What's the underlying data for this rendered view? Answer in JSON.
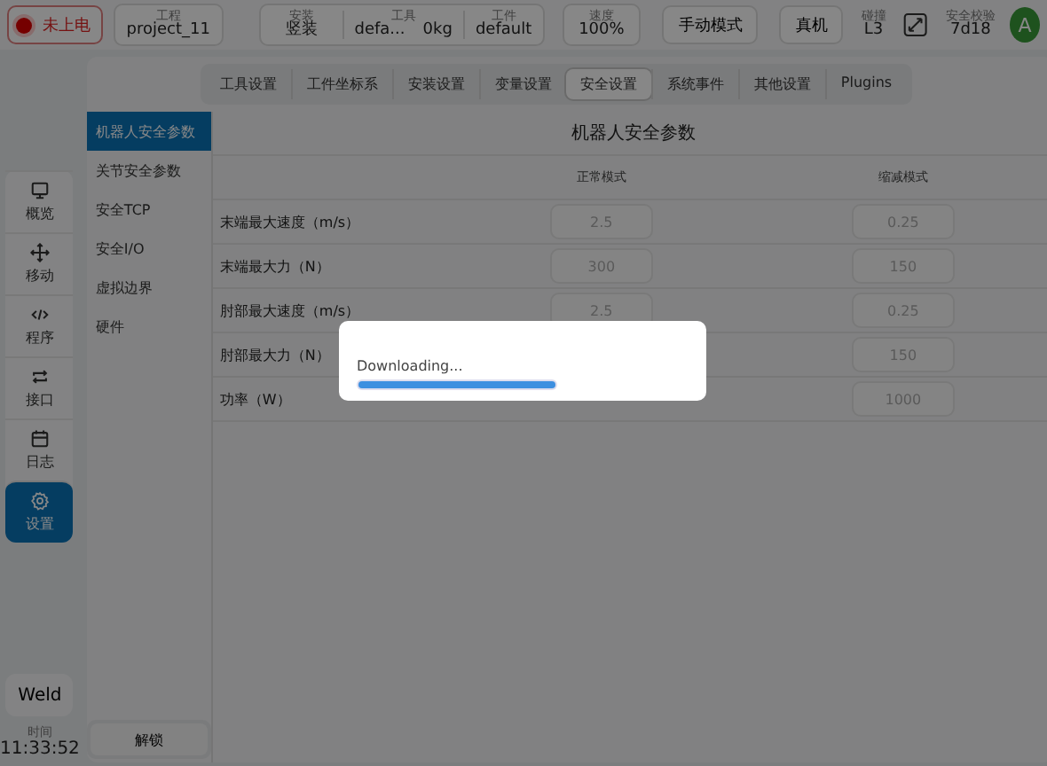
{
  "top_bar": {
    "power_status": "未上电",
    "project": {
      "label": "工程",
      "value": "project_11"
    },
    "install_group": [
      {
        "label": "安装",
        "value": "竖装"
      },
      {
        "label": "工具",
        "value": "defa...",
        "extra": "0kg"
      },
      {
        "label": "工件",
        "value": "default"
      }
    ],
    "speed": {
      "label": "速度",
      "value": "100%"
    },
    "mode_button": "手动模式",
    "machine_button": "真机",
    "collision": {
      "label": "碰撞",
      "value": "L3"
    },
    "safety_check": {
      "label": "安全校验",
      "value": "7d18"
    },
    "avatar": "A"
  },
  "nav": [
    {
      "label": "概览",
      "kind": "monitor",
      "selected": false
    },
    {
      "label": "移动",
      "kind": "move",
      "selected": false
    },
    {
      "label": "程序",
      "kind": "code",
      "selected": false
    },
    {
      "label": "接口",
      "kind": "swap",
      "selected": false
    },
    {
      "label": "日志",
      "kind": "calendar",
      "selected": false
    },
    {
      "label": "设置",
      "kind": "gear",
      "selected": true
    }
  ],
  "weld_button": "Weld",
  "clock": {
    "label": "时间",
    "value": "11:33:52"
  },
  "tabs": [
    {
      "label": "工具设置",
      "selected": false
    },
    {
      "label": "工件坐标系",
      "selected": false
    },
    {
      "label": "安装设置",
      "selected": false
    },
    {
      "label": "变量设置",
      "selected": false
    },
    {
      "label": "安全设置",
      "selected": true
    },
    {
      "label": "系统事件",
      "selected": false
    },
    {
      "label": "其他设置",
      "selected": false
    },
    {
      "label": "Plugins",
      "selected": false
    }
  ],
  "sub_menu": [
    {
      "label": "机器人安全参数",
      "selected": true
    },
    {
      "label": "关节安全参数",
      "selected": false
    },
    {
      "label": "安全TCP",
      "selected": false
    },
    {
      "label": "安全I/O",
      "selected": false
    },
    {
      "label": "虚拟边界",
      "selected": false
    },
    {
      "label": "硬件",
      "selected": false
    }
  ],
  "unlock_button": "解锁",
  "panel_title": "机器人安全参数",
  "table": {
    "columns": [
      "正常模式",
      "缩减模式"
    ],
    "rows": [
      {
        "label": "末端最大速度（m/s）",
        "normal": "2.5",
        "reduced": "0.25"
      },
      {
        "label": "末端最大力（N）",
        "normal": "300",
        "reduced": "150"
      },
      {
        "label": "肘部最大速度（m/s）",
        "normal": "2.5",
        "reduced": "0.25"
      },
      {
        "label": "肘部最大力（N）",
        "reduced": "150"
      },
      {
        "label": "功率（W）",
        "reduced": "1000"
      }
    ]
  },
  "dialog": {
    "message": "Downloading...",
    "level": 1
  }
}
